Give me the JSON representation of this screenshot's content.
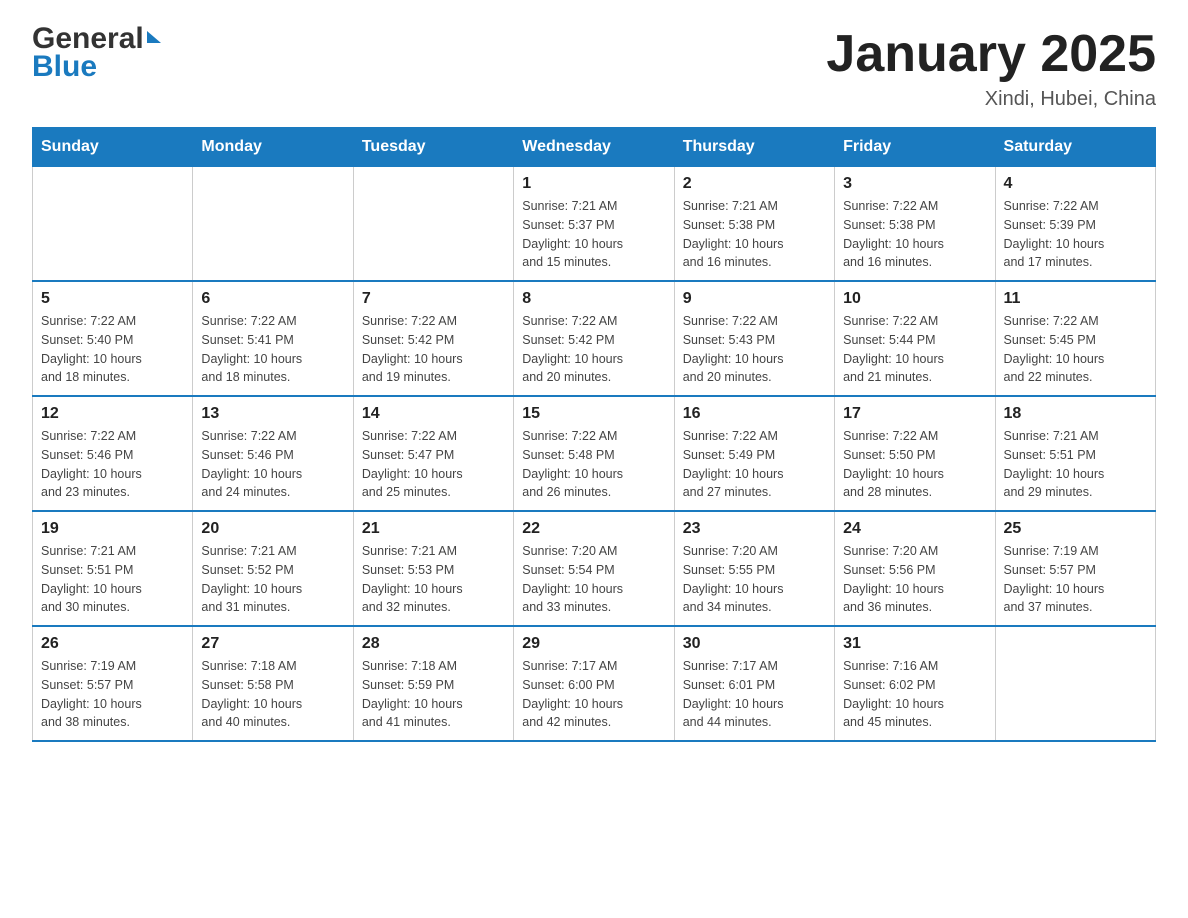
{
  "header": {
    "logo_line1": "General",
    "logo_line2": "Blue",
    "main_title": "January 2025",
    "subtitle": "Xindi, Hubei, China"
  },
  "calendar": {
    "days_of_week": [
      "Sunday",
      "Monday",
      "Tuesday",
      "Wednesday",
      "Thursday",
      "Friday",
      "Saturday"
    ],
    "weeks": [
      [
        {
          "day": "",
          "info": ""
        },
        {
          "day": "",
          "info": ""
        },
        {
          "day": "",
          "info": ""
        },
        {
          "day": "1",
          "info": "Sunrise: 7:21 AM\nSunset: 5:37 PM\nDaylight: 10 hours\nand 15 minutes."
        },
        {
          "day": "2",
          "info": "Sunrise: 7:21 AM\nSunset: 5:38 PM\nDaylight: 10 hours\nand 16 minutes."
        },
        {
          "day": "3",
          "info": "Sunrise: 7:22 AM\nSunset: 5:38 PM\nDaylight: 10 hours\nand 16 minutes."
        },
        {
          "day": "4",
          "info": "Sunrise: 7:22 AM\nSunset: 5:39 PM\nDaylight: 10 hours\nand 17 minutes."
        }
      ],
      [
        {
          "day": "5",
          "info": "Sunrise: 7:22 AM\nSunset: 5:40 PM\nDaylight: 10 hours\nand 18 minutes."
        },
        {
          "day": "6",
          "info": "Sunrise: 7:22 AM\nSunset: 5:41 PM\nDaylight: 10 hours\nand 18 minutes."
        },
        {
          "day": "7",
          "info": "Sunrise: 7:22 AM\nSunset: 5:42 PM\nDaylight: 10 hours\nand 19 minutes."
        },
        {
          "day": "8",
          "info": "Sunrise: 7:22 AM\nSunset: 5:42 PM\nDaylight: 10 hours\nand 20 minutes."
        },
        {
          "day": "9",
          "info": "Sunrise: 7:22 AM\nSunset: 5:43 PM\nDaylight: 10 hours\nand 20 minutes."
        },
        {
          "day": "10",
          "info": "Sunrise: 7:22 AM\nSunset: 5:44 PM\nDaylight: 10 hours\nand 21 minutes."
        },
        {
          "day": "11",
          "info": "Sunrise: 7:22 AM\nSunset: 5:45 PM\nDaylight: 10 hours\nand 22 minutes."
        }
      ],
      [
        {
          "day": "12",
          "info": "Sunrise: 7:22 AM\nSunset: 5:46 PM\nDaylight: 10 hours\nand 23 minutes."
        },
        {
          "day": "13",
          "info": "Sunrise: 7:22 AM\nSunset: 5:46 PM\nDaylight: 10 hours\nand 24 minutes."
        },
        {
          "day": "14",
          "info": "Sunrise: 7:22 AM\nSunset: 5:47 PM\nDaylight: 10 hours\nand 25 minutes."
        },
        {
          "day": "15",
          "info": "Sunrise: 7:22 AM\nSunset: 5:48 PM\nDaylight: 10 hours\nand 26 minutes."
        },
        {
          "day": "16",
          "info": "Sunrise: 7:22 AM\nSunset: 5:49 PM\nDaylight: 10 hours\nand 27 minutes."
        },
        {
          "day": "17",
          "info": "Sunrise: 7:22 AM\nSunset: 5:50 PM\nDaylight: 10 hours\nand 28 minutes."
        },
        {
          "day": "18",
          "info": "Sunrise: 7:21 AM\nSunset: 5:51 PM\nDaylight: 10 hours\nand 29 minutes."
        }
      ],
      [
        {
          "day": "19",
          "info": "Sunrise: 7:21 AM\nSunset: 5:51 PM\nDaylight: 10 hours\nand 30 minutes."
        },
        {
          "day": "20",
          "info": "Sunrise: 7:21 AM\nSunset: 5:52 PM\nDaylight: 10 hours\nand 31 minutes."
        },
        {
          "day": "21",
          "info": "Sunrise: 7:21 AM\nSunset: 5:53 PM\nDaylight: 10 hours\nand 32 minutes."
        },
        {
          "day": "22",
          "info": "Sunrise: 7:20 AM\nSunset: 5:54 PM\nDaylight: 10 hours\nand 33 minutes."
        },
        {
          "day": "23",
          "info": "Sunrise: 7:20 AM\nSunset: 5:55 PM\nDaylight: 10 hours\nand 34 minutes."
        },
        {
          "day": "24",
          "info": "Sunrise: 7:20 AM\nSunset: 5:56 PM\nDaylight: 10 hours\nand 36 minutes."
        },
        {
          "day": "25",
          "info": "Sunrise: 7:19 AM\nSunset: 5:57 PM\nDaylight: 10 hours\nand 37 minutes."
        }
      ],
      [
        {
          "day": "26",
          "info": "Sunrise: 7:19 AM\nSunset: 5:57 PM\nDaylight: 10 hours\nand 38 minutes."
        },
        {
          "day": "27",
          "info": "Sunrise: 7:18 AM\nSunset: 5:58 PM\nDaylight: 10 hours\nand 40 minutes."
        },
        {
          "day": "28",
          "info": "Sunrise: 7:18 AM\nSunset: 5:59 PM\nDaylight: 10 hours\nand 41 minutes."
        },
        {
          "day": "29",
          "info": "Sunrise: 7:17 AM\nSunset: 6:00 PM\nDaylight: 10 hours\nand 42 minutes."
        },
        {
          "day": "30",
          "info": "Sunrise: 7:17 AM\nSunset: 6:01 PM\nDaylight: 10 hours\nand 44 minutes."
        },
        {
          "day": "31",
          "info": "Sunrise: 7:16 AM\nSunset: 6:02 PM\nDaylight: 10 hours\nand 45 minutes."
        },
        {
          "day": "",
          "info": ""
        }
      ]
    ]
  }
}
